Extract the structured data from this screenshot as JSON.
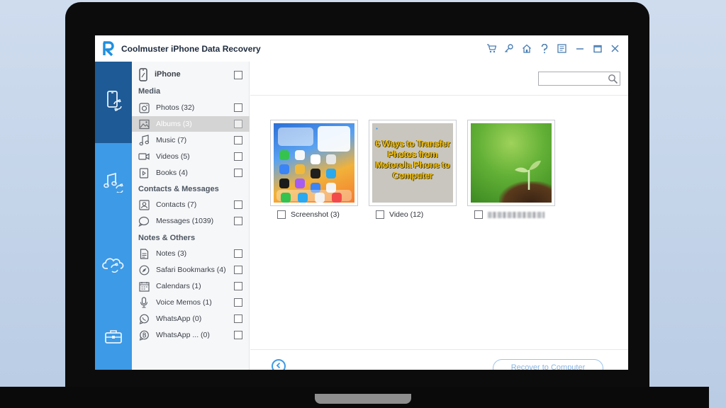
{
  "window": {
    "title": "Coolmuster iPhone Data Recovery"
  },
  "titlebar_icons": [
    "cart-icon",
    "key-icon",
    "home-icon",
    "help-icon",
    "feedback-icon",
    "minimize-icon",
    "maximize-icon",
    "close-icon"
  ],
  "rail": {
    "items": [
      {
        "name": "recover-from-device",
        "icon": "phone-sync-icon",
        "active": true
      },
      {
        "name": "recover-from-itunes-backup",
        "icon": "music-sync-icon",
        "active": false
      },
      {
        "name": "recover-from-icloud",
        "icon": "cloud-sync-icon",
        "active": false
      },
      {
        "name": "toolkit",
        "icon": "toolbox-icon",
        "active": false
      }
    ]
  },
  "categories": {
    "device_label": "iPhone",
    "sections": [
      {
        "title": "Media",
        "items": [
          {
            "label": "Photos  (32)",
            "icon": "camera-icon",
            "selected": false
          },
          {
            "label": "Albums  (3)",
            "icon": "image-icon",
            "selected": true
          },
          {
            "label": "Music  (7)",
            "icon": "music-note-icon",
            "selected": false
          },
          {
            "label": "Videos  (5)",
            "icon": "video-camera-icon",
            "selected": false
          },
          {
            "label": "Books  (4)",
            "icon": "book-icon",
            "selected": false
          }
        ]
      },
      {
        "title": "Contacts & Messages",
        "items": [
          {
            "label": "Contacts  (7)",
            "icon": "contact-card-icon",
            "selected": false
          },
          {
            "label": "Messages  (1039)",
            "icon": "message-bubble-icon",
            "selected": false
          }
        ]
      },
      {
        "title": "Notes & Others",
        "items": [
          {
            "label": "Notes  (3)",
            "icon": "note-icon",
            "selected": false
          },
          {
            "label": "Safari Bookmarks  (4)",
            "icon": "compass-icon",
            "selected": false
          },
          {
            "label": "Calendars  (1)",
            "icon": "calendar-icon",
            "selected": false
          },
          {
            "label": "Voice Memos  (1)",
            "icon": "microphone-icon",
            "selected": false
          },
          {
            "label": "WhatsApp  (0)",
            "icon": "whatsapp-icon",
            "selected": false
          },
          {
            "label": "WhatsApp ...  (0)",
            "icon": "whatsapp-business-icon",
            "selected": false
          }
        ]
      }
    ]
  },
  "search": {
    "placeholder": ""
  },
  "albums": [
    {
      "label": "Screenshot (3)",
      "thumb": "phone-home-screen"
    },
    {
      "label": "Video (12)",
      "thumb": "video-title-card",
      "thumb_text": "6 Ways to Transfer Photos from Motorola Phone to Computer"
    },
    {
      "label": "",
      "thumb": "sprout-photo",
      "label_blurred": true
    }
  ],
  "footer": {
    "recover_label": "Recover to Computer"
  },
  "colors": {
    "rail_blue": "#3d9ae6",
    "rail_active": "#1d5a96",
    "selected_row": "#d4d4d4",
    "accent": "#3d9ae6"
  }
}
